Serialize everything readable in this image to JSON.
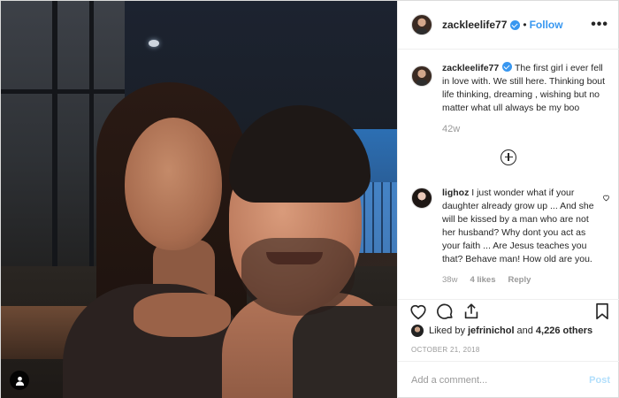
{
  "post": {
    "author": "zackleelife77",
    "follow_label": "Follow",
    "separator": "•",
    "more_label": "•••",
    "caption": "The first girl i ever fell in love with. We still here. Thinking bout life thinking, dreaming , wishing but no matter what ull always be my boo",
    "caption_time": "42w",
    "date": "OCTOBER 21, 2018"
  },
  "comment": {
    "user": "lighoz",
    "text": "I just wonder what if your daughter already grow up ... And she will be kissed by a man who are not her husband? Why dont you act as your faith ... Are Jesus teaches you that? Behave man! How old are you.",
    "time": "38w",
    "likes": "4 likes",
    "reply_label": "Reply"
  },
  "likes": {
    "prefix": "Liked by",
    "user": "jefrinichol",
    "middle": "and",
    "count": "4,226 others"
  },
  "add_comment": {
    "placeholder": "Add a comment...",
    "post_label": "Post"
  },
  "icons": {
    "like": "heart-icon",
    "comment": "comment-icon",
    "share": "share-icon",
    "save": "bookmark-icon",
    "load_more": "plus-circle-icon",
    "user_tag": "person-icon",
    "verified": "verified-badge-icon"
  },
  "colors": {
    "accent": "#3897f0",
    "muted": "#999999",
    "post_disabled": "#b2dffc"
  }
}
